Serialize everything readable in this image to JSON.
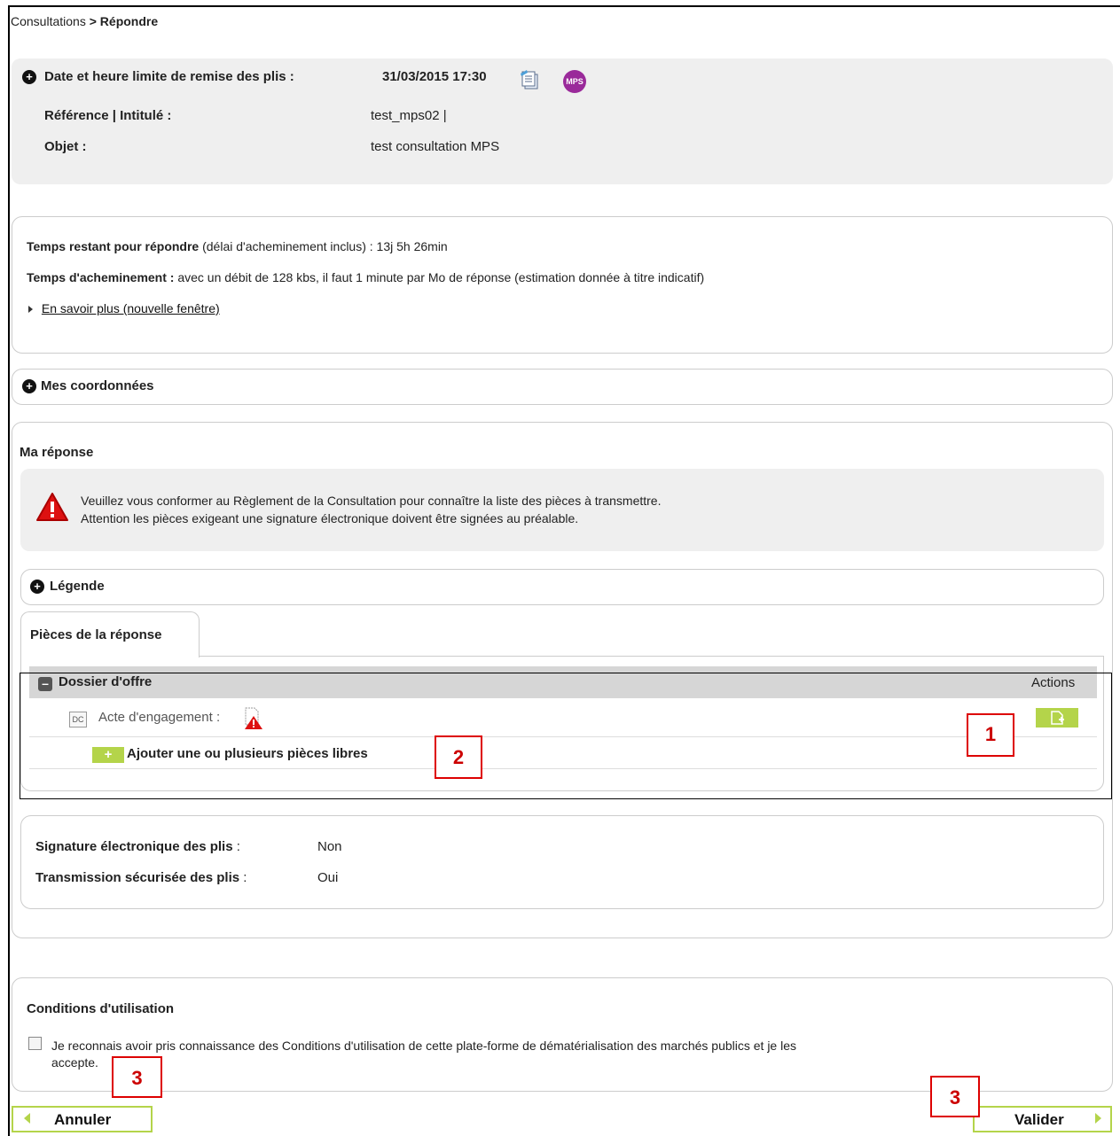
{
  "breadcrumb": {
    "parent": "Consultations",
    "separator": ">",
    "current": "Répondre"
  },
  "summary": {
    "deadline_label": "Date et heure limite de remise des plis :",
    "deadline_value": "31/03/2015 17:30",
    "mps_badge": "MPS",
    "reference_label": "Référence | Intitulé :",
    "reference_value": "test_mps02 |",
    "objet_label": "Objet :",
    "objet_value": "test consultation MPS"
  },
  "timing": {
    "remaining_label": "Temps restant pour répondre",
    "remaining_note": "(délai d'acheminement inclus) :",
    "remaining_value": "13j 5h 26min",
    "transfer_label": "Temps d'acheminement :",
    "transfer_value": "avec un débit de 128 kbs, il faut 1 minute par Mo de réponse (estimation donnée à titre indicatif)",
    "learn_more_link": "En savoir plus (nouvelle fenêtre)"
  },
  "coordonnees": {
    "title": "Mes coordonnées"
  },
  "reponse": {
    "title": "Ma réponse",
    "warning_line1": "Veuillez vous conformer au Règlement de la Consultation pour connaître la liste des pièces à transmettre.",
    "warning_line2": "Attention les pièces exigeant une signature électronique doivent être signées au préalable.",
    "legend_title": "Légende",
    "tab_label": "Pièces de la réponse",
    "dossier_label": "Dossier d'offre",
    "actions_header": "Actions",
    "piece_label": "Acte d'engagement :",
    "piece_icon_text": "DC",
    "add_pieces_label": "Ajouter une ou plusieurs pièces libres"
  },
  "signature": {
    "signature_label": "Signature électronique des plis",
    "signature_value": "Non",
    "transmission_label": "Transmission sécurisée des plis",
    "transmission_value": "Oui",
    "colon": ":"
  },
  "conditions": {
    "title": "Conditions d'utilisation",
    "checkbox_label_line1": "Je reconnais avoir pris connaissance des Conditions d'utilisation de cette plate-forme de dématérialisation des marchés publics et je les",
    "checkbox_label_line2": "accepte.",
    "checked": false
  },
  "buttons": {
    "cancel": "Annuler",
    "submit": "Valider"
  },
  "annotations": {
    "one": "1",
    "two": "2",
    "three_a": "3",
    "three_b": "3"
  },
  "colors": {
    "accent_green": "#b4d44a",
    "annotation_red": "#d00000",
    "warning_red": "#d11"
  }
}
